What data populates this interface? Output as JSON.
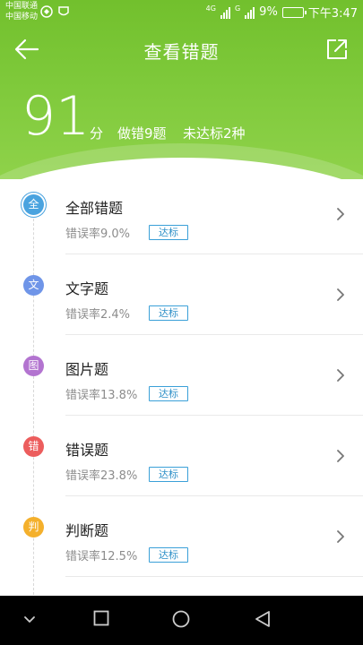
{
  "status_bar": {
    "carrier_1": "中国联通",
    "carrier_2": "中国移动",
    "network_1": "4G",
    "network_2": "G",
    "battery_percent": "9%",
    "time": "下午3:47"
  },
  "header": {
    "title": "查看错题",
    "back_icon": "arrow-left-icon",
    "share_icon": "share-out-icon"
  },
  "score": {
    "value": "91",
    "unit": "分",
    "wrong_count": "做错9题",
    "not_passed": "未达标2种"
  },
  "colors": {
    "header_green": "#7ec93a",
    "tag_blue": "#2f90c8"
  },
  "items": [
    {
      "badge": "全",
      "badge_color": "#4aa3df",
      "title": "全部错题",
      "rate": "错误率9.0%",
      "tag": "达标"
    },
    {
      "badge": "文",
      "badge_color": "#6f95e8",
      "title": "文字题",
      "rate": "错误率2.4%",
      "tag": "达标"
    },
    {
      "badge": "图",
      "badge_color": "#b374d0",
      "title": "图片题",
      "rate": "错误率13.8%",
      "tag": "达标"
    },
    {
      "badge": "错",
      "badge_color": "#ec5d5d",
      "title": "错误题",
      "rate": "错误率23.8%",
      "tag": "达标"
    },
    {
      "badge": "判",
      "badge_color": "#f4b02c",
      "title": "判断题",
      "rate": "错误率12.5%",
      "tag": "达标"
    }
  ],
  "system_nav": {
    "buttons": [
      "chevron-down-icon",
      "square-recent-icon",
      "circle-home-icon",
      "triangle-back-icon"
    ]
  }
}
